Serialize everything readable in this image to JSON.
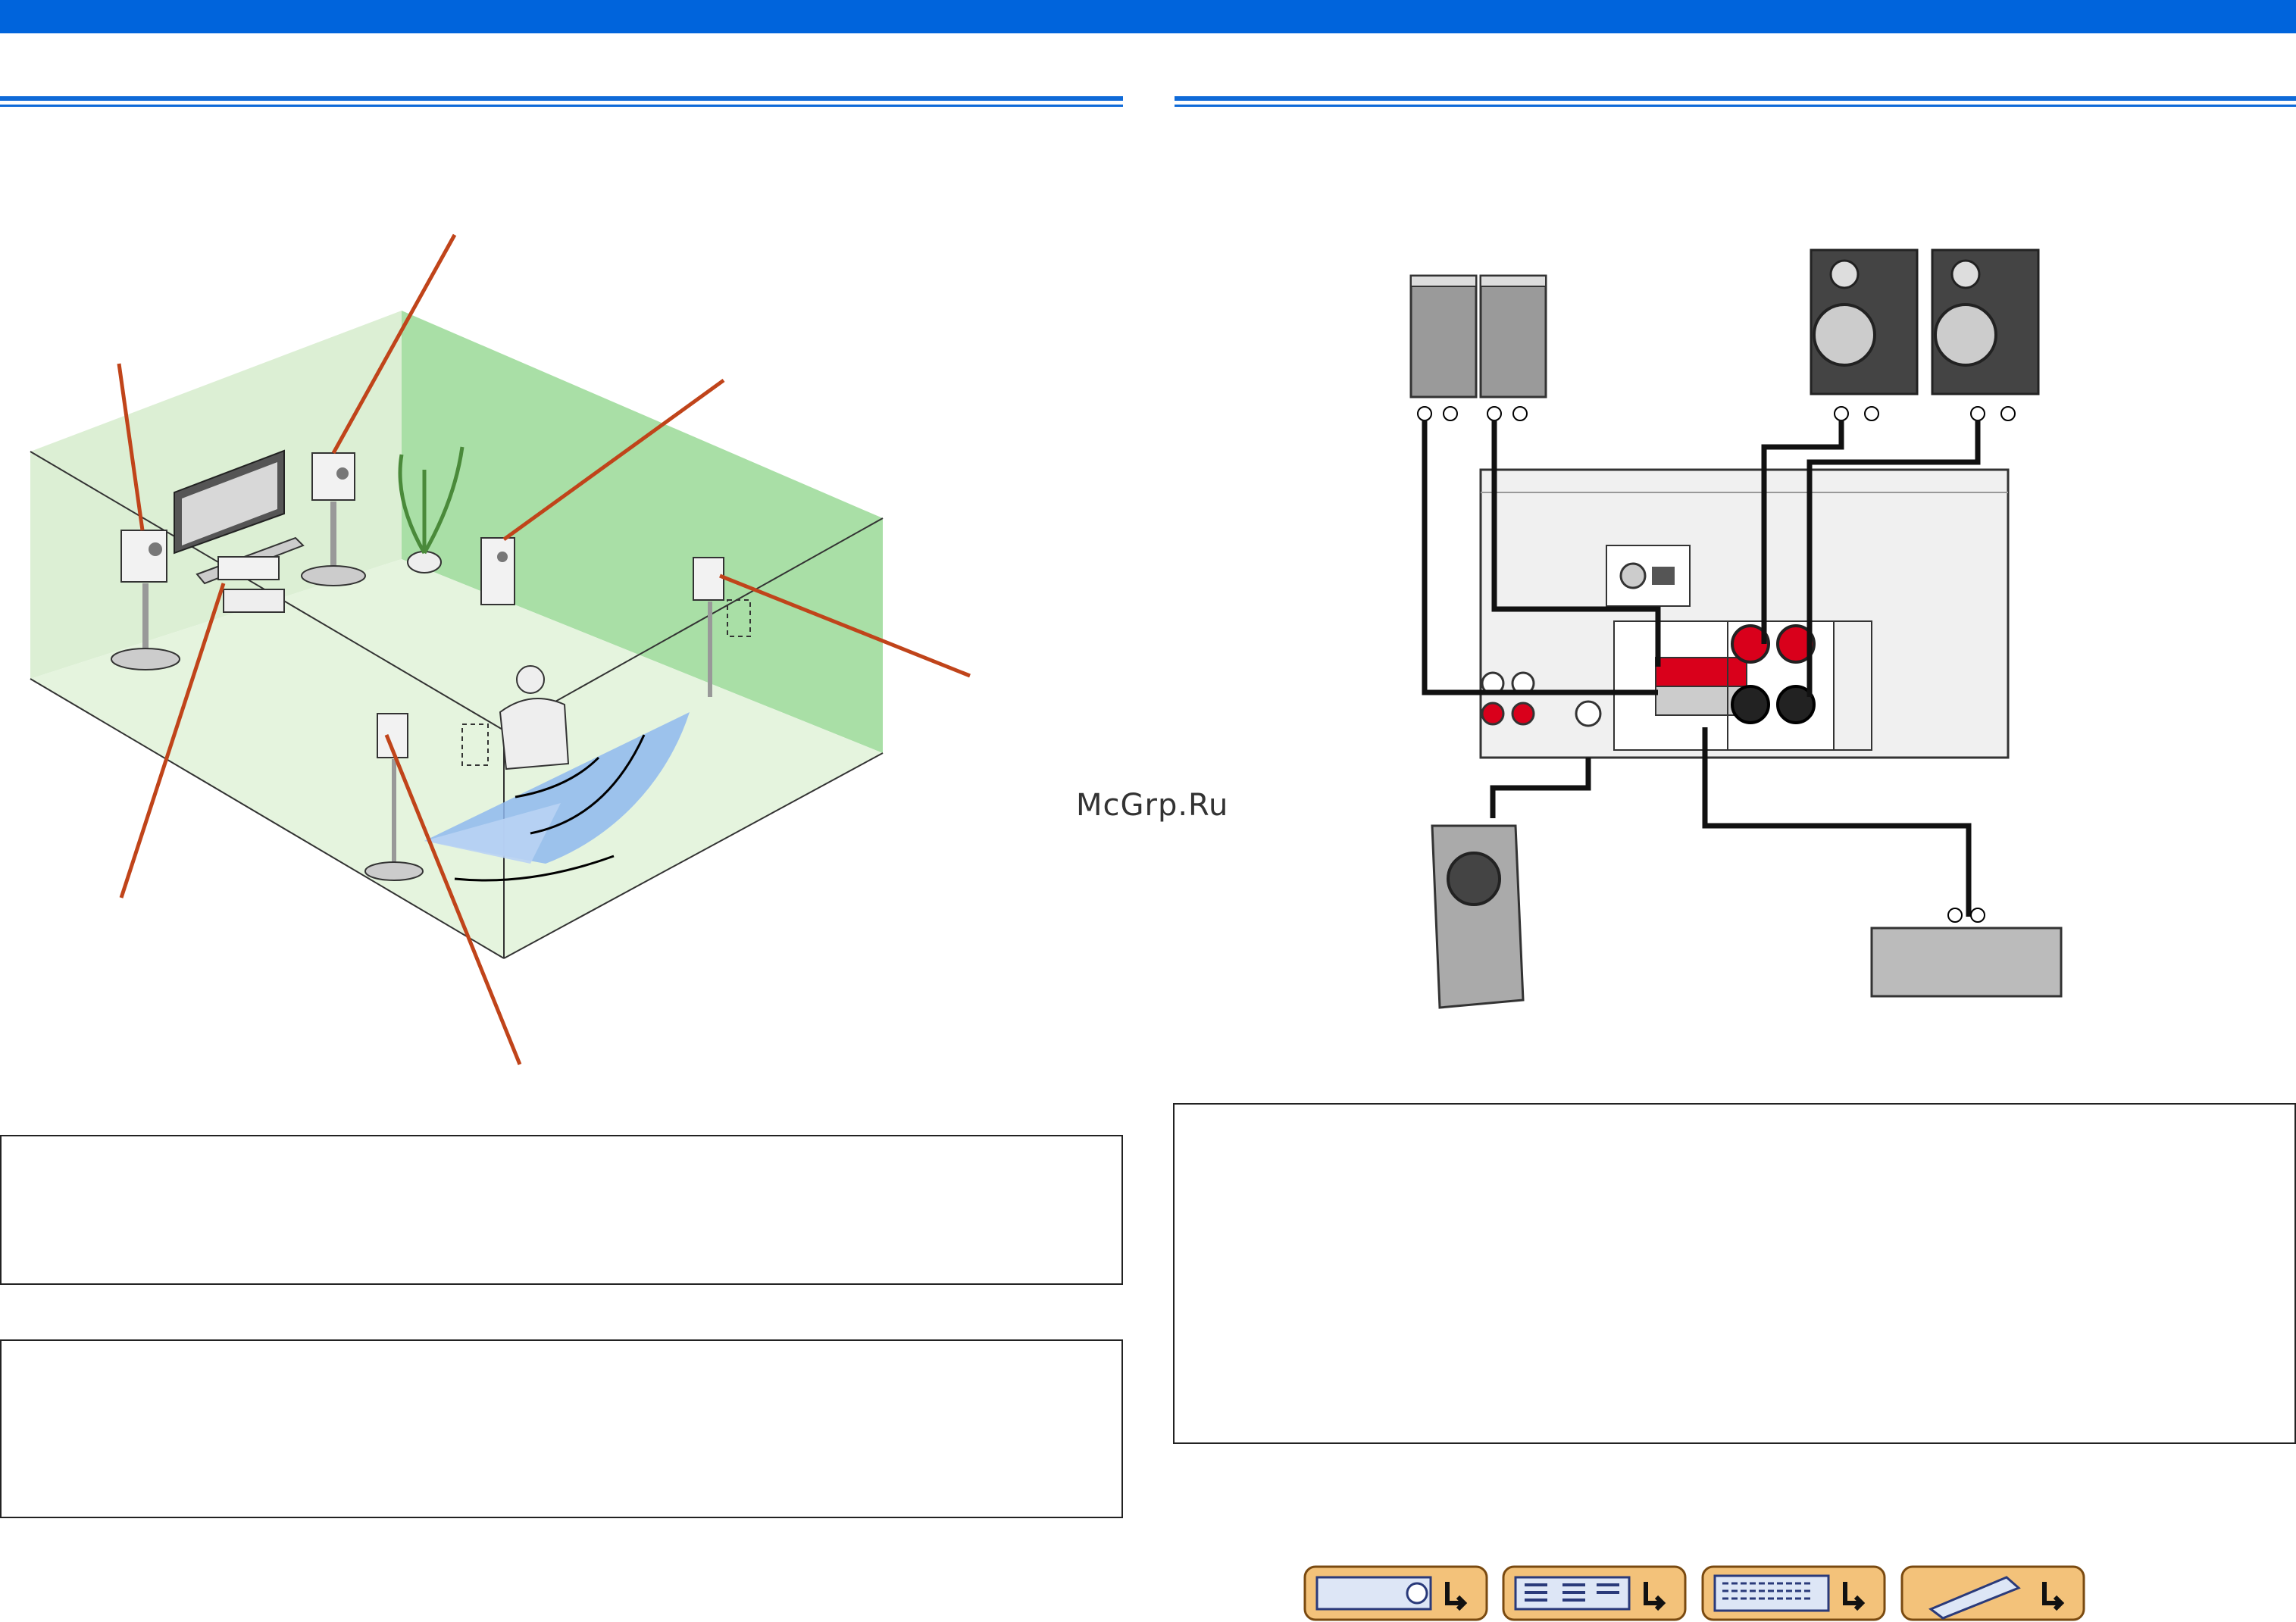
{
  "watermark": "McGrp.Ru",
  "colors": {
    "header_blue": "#0064dc",
    "room_green": "#a9dfa6",
    "floor_green": "#e3f4dc",
    "listening_blue": "#8fb8ee",
    "callout_line": "#c0441a",
    "terminal_red": "#d9001b"
  },
  "nav_buttons": [
    {
      "icon": "receiver-front-panel-icon"
    },
    {
      "icon": "receiver-rear-panel-icon"
    },
    {
      "icon": "front-display-icon"
    },
    {
      "icon": "remote-control-icon"
    }
  ]
}
